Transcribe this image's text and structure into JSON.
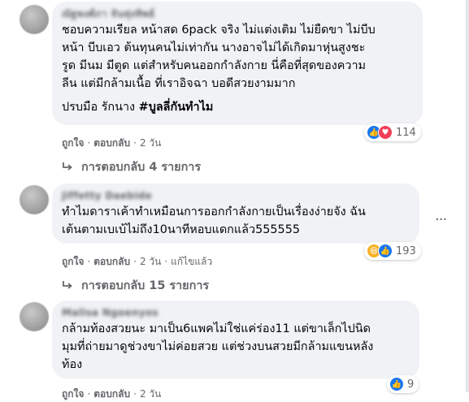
{
  "comments": [
    {
      "author": "ณัฐพงศ์ภา จันทุ่งทิพย์",
      "text": "ชอบความเรียล หน้าสด 6pack จริง ไม่แต่งเติม ไม่ยืดขา ไม่บีบ\nหน้า บีบเอว ต้นทุนคนไม่เท่ากัน นางอาจไม่ได้เกิดมาหุ่นสูงชะ\nรูด มีนม มีตูด แต่สำหรับคนออกกำลังกาย นี่คือที่สุดของความ\nลีน แต่มีกล้ามเนื้อ ที่เราอิจฉา บอดีสวยงามมาก",
      "text2_plain": "ปรบมือ รักนาง ",
      "text2_bold": "#บูลลี่กันทำไม",
      "like_label": "ถูกใจ",
      "reply_label": "ตอบกลับ",
      "time": "2 วัน",
      "edited": "",
      "reaction_count": "114",
      "reactions": [
        "like-icon",
        "love-icon"
      ],
      "replies_label": "การตอบกลับ 4 รายการ"
    },
    {
      "author": "Jiffetty Daebide",
      "text": "ทำไมดาราเค้าทำเหมือนการออกกำลังกายเป็นเรื่องง่ายจัง ฉัน\nเต้นตามเบเบ้ไม่ถึง10นาทีหอบแดกแล้ว555555",
      "like_label": "ถูกใจ",
      "reply_label": "ตอบกลับ",
      "time": "2 วัน",
      "edited": "แก้ไขแล้ว",
      "reaction_count": "193",
      "reactions": [
        "haha-icon",
        "like-icon"
      ],
      "replies_label": "การตอบกลับ 15 รายการ",
      "more_label": "···"
    },
    {
      "author": "Malisa Ngoenyos",
      "text": "กล้ามท้องสวยนะ มาเป็น6แพคไม่ใช่แค่ร่อง11 แต่ขาเล็กไปนิด\nมุมที่ถ่ายมาดูช่วงขาไม่ค่อยสวย แต่ช่วงบนสวยมีกล้ามแขนหลัง\nท้อง",
      "like_label": "ถูกใจ",
      "reply_label": "ตอบกลับ",
      "time": "2 วัน",
      "reaction_count": "9",
      "reactions": [
        "like-icon"
      ]
    }
  ],
  "colors": {
    "bubble": "#f0f2f5",
    "muted_text": "#65676b",
    "like_blue": "#1877f2",
    "love_red": "#f33e58",
    "haha_yellow": "#f7b125"
  }
}
